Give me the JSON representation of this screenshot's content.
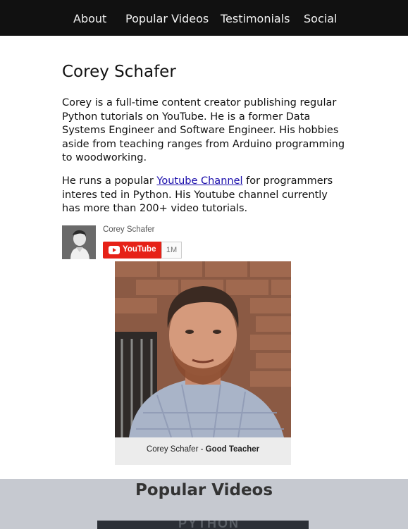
{
  "nav": {
    "items": [
      "About",
      "Popular Videos",
      "Testimonials",
      "Social"
    ]
  },
  "profile": {
    "name": "Corey Schafer",
    "bio": "Corey is a full-time content creator publishing regular Python tutorials on YouTube. He is a former Data Systems Engineer and Software Engineer. His hobbies aside from teaching ranges from Arduino programming to woodworking.",
    "runs_prefix": "He runs a popular ",
    "runs_link": "Youtube Channel",
    "runs_suffix": " for programmers interes ted in Python. His Youtube channel currently has more than 200+ video tutorials."
  },
  "youtube_widget": {
    "channel_name": "Corey Schafer",
    "button_label": "YouTube",
    "subscriber_count": "1M",
    "accent": "#e62117"
  },
  "photo": {
    "caption_name": "Corey Schafer",
    "caption_sep": " - ",
    "caption_title": "Good Teacher"
  },
  "videos_section": {
    "title": "Popular Videos",
    "thumb_text": "PYTHON",
    "background": "#c6c9d0"
  }
}
